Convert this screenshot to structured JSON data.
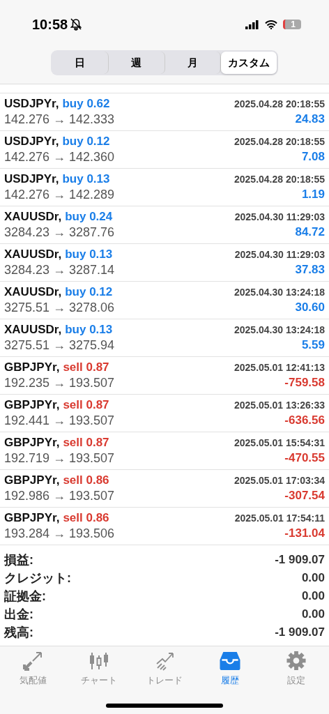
{
  "status_bar": {
    "time": "10:58",
    "battery": "1"
  },
  "period_tabs": [
    {
      "label": "日",
      "selected": false
    },
    {
      "label": "週",
      "selected": false
    },
    {
      "label": "月",
      "selected": false
    },
    {
      "label": "カスタム",
      "selected": true
    }
  ],
  "deals": [
    {
      "symbol": "USDJPYr,",
      "kind": "buy",
      "type": "buy 0.62",
      "time": "2025.04.28 20:18:55",
      "prices": "142.276 → 142.333",
      "profit": "24.83"
    },
    {
      "symbol": "USDJPYr,",
      "kind": "buy",
      "type": "buy 0.12",
      "time": "2025.04.28 20:18:55",
      "prices": "142.276 → 142.360",
      "profit": "7.08"
    },
    {
      "symbol": "USDJPYr,",
      "kind": "buy",
      "type": "buy 0.13",
      "time": "2025.04.28 20:18:55",
      "prices": "142.276 → 142.289",
      "profit": "1.19"
    },
    {
      "symbol": "XAUUSDr,",
      "kind": "buy",
      "type": "buy 0.24",
      "time": "2025.04.30 11:29:03",
      "prices": "3284.23 → 3287.76",
      "profit": "84.72"
    },
    {
      "symbol": "XAUUSDr,",
      "kind": "buy",
      "type": "buy 0.13",
      "time": "2025.04.30 11:29:03",
      "prices": "3284.23 → 3287.14",
      "profit": "37.83"
    },
    {
      "symbol": "XAUUSDr,",
      "kind": "buy",
      "type": "buy 0.12",
      "time": "2025.04.30 13:24:18",
      "prices": "3275.51 → 3278.06",
      "profit": "30.60"
    },
    {
      "symbol": "XAUUSDr,",
      "kind": "buy",
      "type": "buy 0.13",
      "time": "2025.04.30 13:24:18",
      "prices": "3275.51 → 3275.94",
      "profit": "5.59"
    },
    {
      "symbol": "GBPJPYr,",
      "kind": "sell",
      "type": "sell 0.87",
      "time": "2025.05.01 12:41:13",
      "prices": "192.235 → 193.507",
      "profit": "-759.58"
    },
    {
      "symbol": "GBPJPYr,",
      "kind": "sell",
      "type": "sell 0.87",
      "time": "2025.05.01 13:26:33",
      "prices": "192.441 → 193.507",
      "profit": "-636.56"
    },
    {
      "symbol": "GBPJPYr,",
      "kind": "sell",
      "type": "sell 0.87",
      "time": "2025.05.01 15:54:31",
      "prices": "192.719 → 193.507",
      "profit": "-470.55"
    },
    {
      "symbol": "GBPJPYr,",
      "kind": "sell",
      "type": "sell 0.86",
      "time": "2025.05.01 17:03:34",
      "prices": "192.986 → 193.507",
      "profit": "-307.54"
    },
    {
      "symbol": "GBPJPYr,",
      "kind": "sell",
      "type": "sell 0.86",
      "time": "2025.05.01 17:54:11",
      "prices": "193.284 → 193.506",
      "profit": "-131.04"
    }
  ],
  "summary": [
    {
      "label": "損益:",
      "value": "-1 909.07"
    },
    {
      "label": "クレジット:",
      "value": "0.00"
    },
    {
      "label": "証拠金:",
      "value": "0.00"
    },
    {
      "label": "出金:",
      "value": "0.00"
    },
    {
      "label": "残高:",
      "value": "-1 909.07"
    }
  ],
  "tab_bar": [
    {
      "kind": "quotes",
      "label": "気配値",
      "selected": false
    },
    {
      "kind": "chart",
      "label": "チャート",
      "selected": false
    },
    {
      "kind": "trade",
      "label": "トレード",
      "selected": false
    },
    {
      "kind": "history",
      "label": "履歴",
      "selected": true
    },
    {
      "kind": "settings",
      "label": "設定",
      "selected": false
    }
  ]
}
